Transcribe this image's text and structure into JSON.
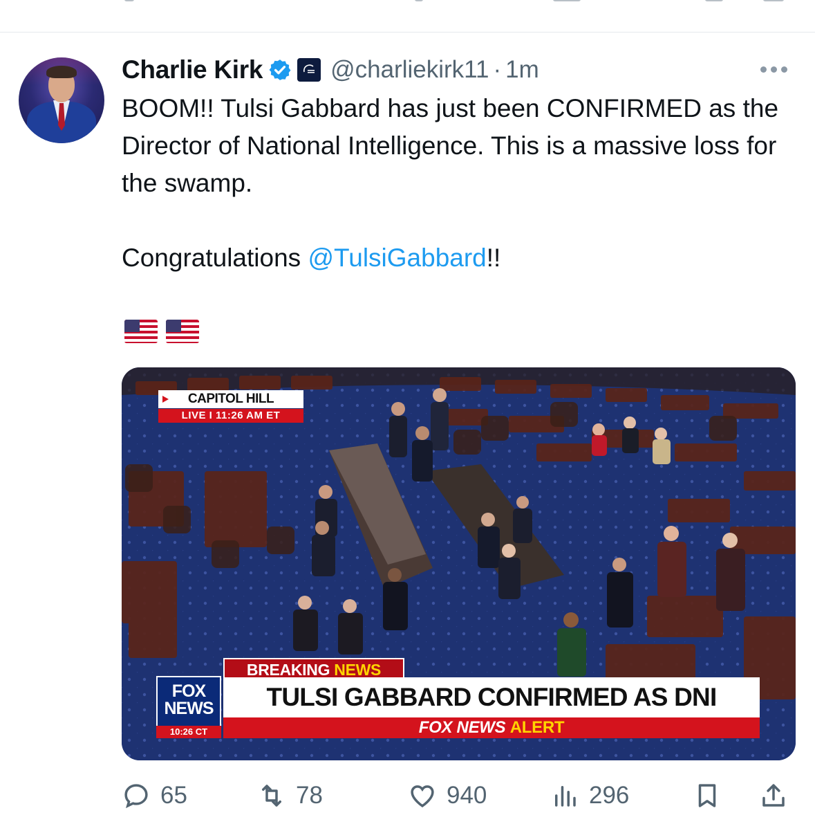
{
  "tweet": {
    "author_name": "Charlie Kirk",
    "handle": "@charliekirk11",
    "separator": "·",
    "time": "1m",
    "text_line1": "BOOM!! Tulsi Gabbard has just been CONFIRMED as the Director of National Intelligence. This is a massive loss for the swamp.",
    "text_congrats": "Congratulations ",
    "mention": "@TulsiGabbard",
    "text_after_mention": "!!",
    "emoji": [
      "us-flag",
      "us-flag"
    ]
  },
  "media": {
    "location_label": "CAPITOL HILL",
    "live_label": "LIVE  I  11:26 AM ET",
    "breaking_label_a": "BREAKING ",
    "breaking_label_b": "NEWS",
    "headline": "TULSI GABBARD CONFIRMED AS DNI",
    "alert_a": "FOX NEWS ",
    "alert_b": "ALERT",
    "logo_line1": "FOX",
    "logo_line2": "NEWS",
    "logo_time": "10:26 CT"
  },
  "actions": {
    "replies": "65",
    "reposts": "78",
    "likes": "940",
    "views": "296"
  },
  "colors": {
    "accent": "#1d9bf0",
    "muted": "#536471",
    "fox_red": "#d4131d",
    "fox_blue": "#0b2a78"
  }
}
